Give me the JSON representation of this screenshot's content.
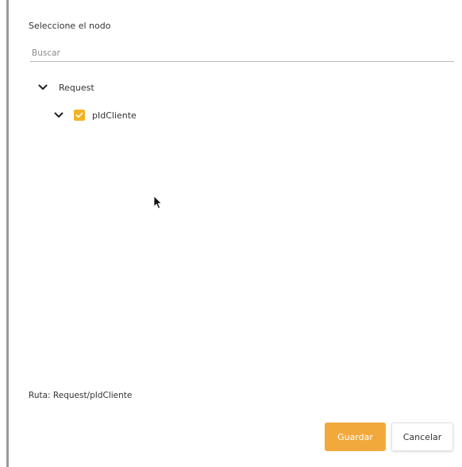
{
  "dialog": {
    "title": "Seleccione el nodo",
    "search": {
      "placeholder": "Buscar",
      "value": ""
    },
    "tree": [
      {
        "label": "Request",
        "expanded": true,
        "icon": "chevron-down-icon"
      },
      {
        "label": "pIdCliente",
        "expanded": true,
        "checked": true,
        "icon": "chevron-down-icon"
      }
    ],
    "route_text": "Ruta: Request/pIdCliente",
    "buttons": {
      "save_label": "Guardar",
      "cancel_label": "Cancelar"
    }
  },
  "colors": {
    "accent": "#f2a93b",
    "checkbox": "#f5b124"
  }
}
